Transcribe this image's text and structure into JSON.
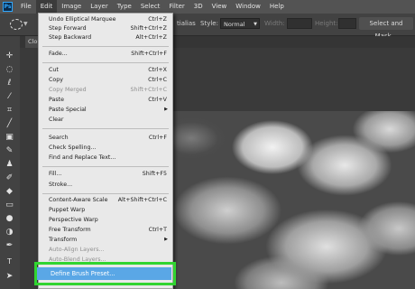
{
  "app": {
    "logo": "Ps"
  },
  "menubar": {
    "items": [
      "File",
      "Edit",
      "Image",
      "Layer",
      "Type",
      "Select",
      "Filter",
      "3D",
      "View",
      "Window",
      "Help"
    ]
  },
  "options_bar": {
    "antialias_label": "tialias",
    "style_label": "Style:",
    "style_value": "Normal",
    "width_label": "Width:",
    "height_label": "Height:",
    "select_mask_label": "Select and Mask..."
  },
  "document_tab": {
    "label": "Clou"
  },
  "tools": [
    "move-tool",
    "marquee-tool",
    "lasso-tool",
    "magic-wand-tool",
    "crop-tool",
    "eyedropper-tool",
    "healing-brush-tool",
    "brush-tool",
    "clone-stamp-tool",
    "history-brush-tool",
    "eraser-tool",
    "gradient-tool",
    "blur-tool",
    "dodge-tool",
    "pen-tool",
    "type-tool",
    "path-selection-tool"
  ],
  "edit_menu": {
    "undo": {
      "label": "Undo Elliptical Marquee",
      "shortcut": "Ctrl+Z"
    },
    "step_forward": {
      "label": "Step Forward",
      "shortcut": "Shift+Ctrl+Z"
    },
    "step_backward": {
      "label": "Step Backward",
      "shortcut": "Alt+Ctrl+Z"
    },
    "fade": {
      "label": "Fade...",
      "shortcut": "Shift+Ctrl+F"
    },
    "cut": {
      "label": "Cut",
      "shortcut": "Ctrl+X"
    },
    "copy": {
      "label": "Copy",
      "shortcut": "Ctrl+C"
    },
    "copy_merged": {
      "label": "Copy Merged",
      "shortcut": "Shift+Ctrl+C"
    },
    "paste": {
      "label": "Paste",
      "shortcut": "Ctrl+V"
    },
    "paste_special": {
      "label": "Paste Special"
    },
    "clear": {
      "label": "Clear"
    },
    "search": {
      "label": "Search",
      "shortcut": "Ctrl+F"
    },
    "check_spelling": {
      "label": "Check Spelling..."
    },
    "find_replace": {
      "label": "Find and Replace Text..."
    },
    "fill": {
      "label": "Fill...",
      "shortcut": "Shift+F5"
    },
    "stroke": {
      "label": "Stroke..."
    },
    "content_aware_scale": {
      "label": "Content-Aware Scale",
      "shortcut": "Alt+Shift+Ctrl+C"
    },
    "puppet_warp": {
      "label": "Puppet Warp"
    },
    "perspective_warp": {
      "label": "Perspective Warp"
    },
    "free_transform": {
      "label": "Free Transform",
      "shortcut": "Ctrl+T"
    },
    "transform": {
      "label": "Transform"
    },
    "auto_align": {
      "label": "Auto-Align Layers..."
    },
    "auto_blend": {
      "label": "Auto-Blend Layers..."
    },
    "define_brush": {
      "label": "Define Brush Preset..."
    }
  },
  "colors": {
    "highlight": "#31d431",
    "selected_row": "#5aa7e6",
    "menu_bg": "#e9e9e9"
  }
}
